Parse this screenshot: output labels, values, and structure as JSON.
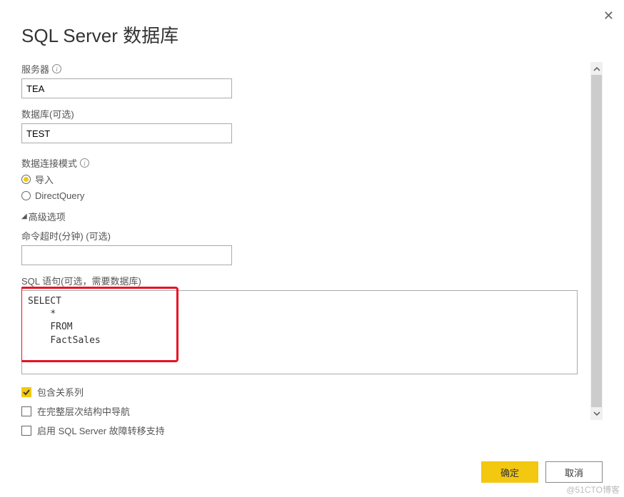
{
  "title": "SQL Server 数据库",
  "close_icon": "close-icon",
  "fields": {
    "server": {
      "label": "服务器",
      "value": "TEA",
      "has_info": true
    },
    "database": {
      "label": "数据库(可选)",
      "value": "TEST",
      "has_info": false
    }
  },
  "connectivity": {
    "label": "数据连接模式",
    "has_info": true,
    "options": [
      {
        "label": "导入",
        "checked": true
      },
      {
        "label": "DirectQuery",
        "checked": false
      }
    ]
  },
  "advanced": {
    "label": "高级选项",
    "expanded": true
  },
  "timeout": {
    "label": "命令超时(分钟) (可选)",
    "value": ""
  },
  "sql": {
    "label": "SQL 语句(可选，需要数据库)",
    "value": "SELECT\n    *\n    FROM\n    FactSales"
  },
  "checkboxes": [
    {
      "label": "包含关系列",
      "checked": true
    },
    {
      "label": "在完整层次结构中导航",
      "checked": false
    },
    {
      "label": "启用 SQL Server 故障转移支持",
      "checked": false
    }
  ],
  "buttons": {
    "ok": "确定",
    "cancel": "取消"
  },
  "watermark": "@51CTO博客"
}
